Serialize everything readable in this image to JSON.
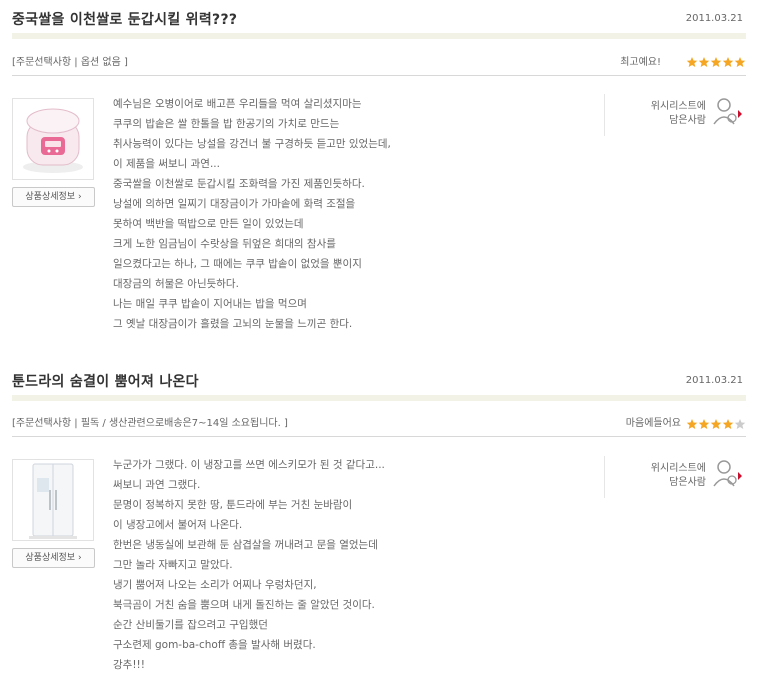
{
  "reviews": [
    {
      "title": "중국쌀을 이천쌀로 둔갑시킬 위력???",
      "date": "2011.03.21",
      "option": "[주문선택사항 | 옵션 없음 ]",
      "rating_label": "최고예요!",
      "rating": 5,
      "detail_button": "상품상세정보",
      "product_icon": "rice-cooker-icon",
      "wishlist": [
        "위시리스트에",
        "담은사람"
      ],
      "lines": [
        "예수님은 오병이어로 배고픈 우리들을 먹여 살리셨지마는",
        "쿠쿠의 밥솥은 쌀 한톨을 밥 한공기의 가치로 만드는",
        "취사능력이 있다는 낭설을 강건너 불 구경하듯 듣고만 있었는데,",
        "이 제품을 써보니 과연...",
        "중국쌀을 이천쌀로 둔갑시킬 조화력을 가진 제품인듯하다.",
        "낭설에 의하면 일찌기 대장금이가 가마솥에 화력 조절을",
        "못하여 백반을 떡밥으로 만든 일이 있었는데",
        "크게 노한 임금님이 수랏상을 뒤엎은 희대의 참사를",
        "일으켰다고는 하나, 그 때에는 쿠쿠 밥솥이 없었을 뿐이지",
        "대장금의 허물은 아닌듯하다.",
        "나는 매일 쿠쿠 밥솥이 지어내는 밥을 먹으며",
        "그 옛날 대장금이가 흘렸을 고뇌의 눈물을 느끼곤 한다."
      ]
    },
    {
      "title": "툰드라의 숨결이 뿜어져 나온다",
      "date": "2011.03.21",
      "option": "[주문선택사항 | 필독 / 생산관련으로배송은7~14일 소요됩니다. ]",
      "rating_label": "마음에들어요",
      "rating": 4,
      "detail_button": "상품상세정보",
      "product_icon": "refrigerator-icon",
      "wishlist": [
        "위시리스트에",
        "담은사람"
      ],
      "lines": [
        "누군가가 그랬다. 이 냉장고를 쓰면 에스키모가 된 것 같다고...",
        "써보니 과연 그랬다.",
        "문명이 정복하지 못한 땅, 툰드라에 부는 거친 눈바람이",
        "이 냉장고에서 불어져 나온다.",
        "한번은 냉동실에 보관해 둔 삼겹살을 꺼내려고 문을 열었는데",
        "그만 놀라 자빠지고 말았다.",
        "냉기 뿜어져 나오는 소리가 어찌나 우렁차던지,",
        "북극곰이 거친 숨을 뿜으며 내게 돌진하는 줄 알았던 것이다.",
        "순간 산비둘기를 잡으려고 구입했던",
        "구소련제 gom-ba-choff 총을 발사해 버렸다.",
        "강추!!!"
      ]
    }
  ],
  "colors": {
    "star_on": "#f5a623",
    "star_off": "#cccccc",
    "title": "#333333",
    "bar": "#f3f2e6",
    "wish_arrow": "#c8102e"
  }
}
